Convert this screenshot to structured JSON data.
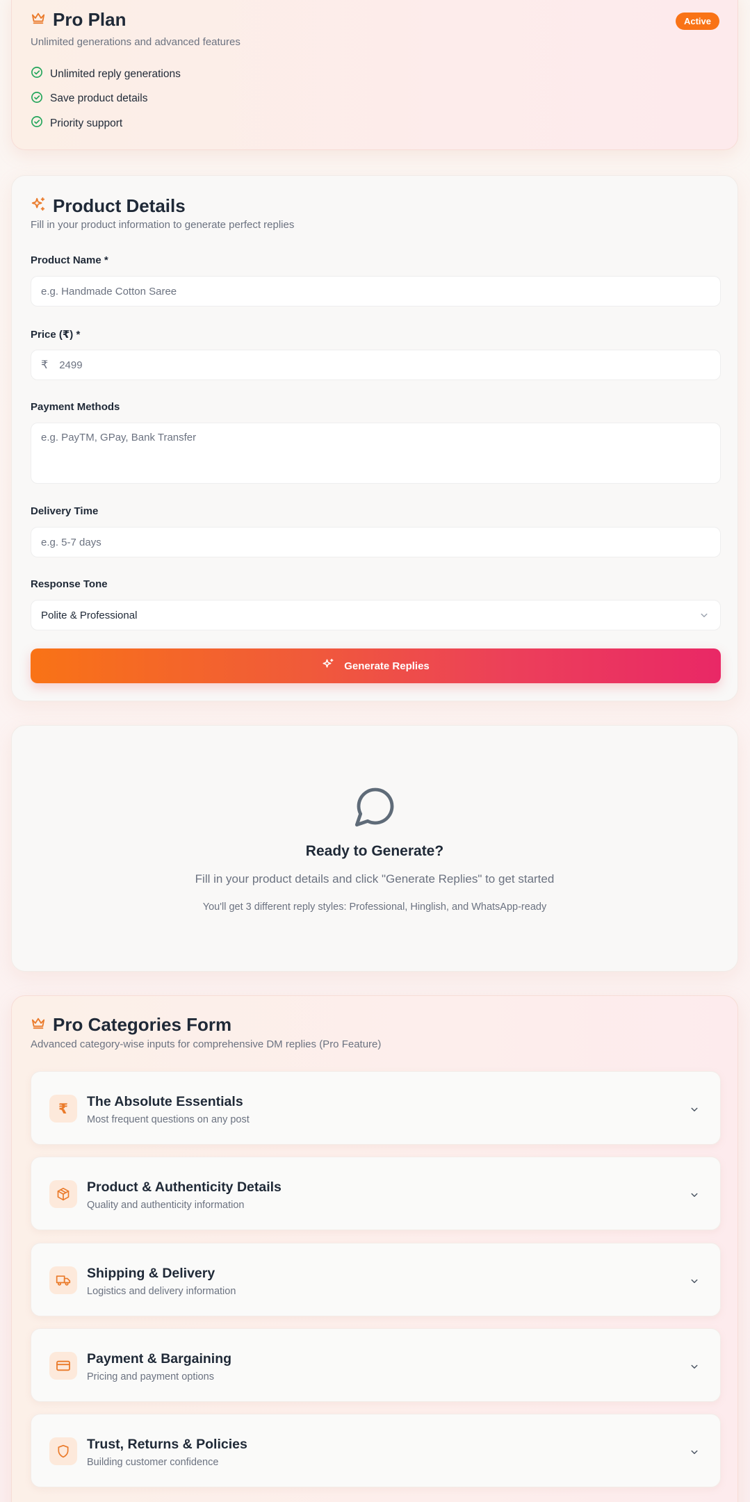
{
  "plan": {
    "title": "Pro Plan",
    "badge": "Active",
    "subtitle": "Unlimited generations and advanced features",
    "features": [
      "Unlimited reply generations",
      "Save product details",
      "Priority support"
    ]
  },
  "details": {
    "title": "Product Details",
    "subtitle": "Fill in your product information to generate perfect replies",
    "product_name": {
      "label": "Product Name *",
      "placeholder": "e.g. Handmade Cotton Saree"
    },
    "price": {
      "label": "Price (₹) *",
      "prefix": "₹",
      "placeholder": "2499"
    },
    "payment": {
      "label": "Payment Methods",
      "placeholder": "e.g. PayTM, GPay, Bank Transfer"
    },
    "delivery": {
      "label": "Delivery Time",
      "placeholder": "e.g. 5-7 days"
    },
    "tone": {
      "label": "Response Tone",
      "value": "Polite & Professional"
    },
    "generate_label": "Generate Replies"
  },
  "empty": {
    "title": "Ready to Generate?",
    "description": "Fill in your product details and click \"Generate Replies\" to get started",
    "note": "You'll get 3 different reply styles: Professional, Hinglish, and WhatsApp-ready"
  },
  "categories": {
    "title": "Pro Categories Form",
    "subtitle": "Advanced category-wise inputs for comprehensive DM replies (Pro Feature)",
    "items": [
      {
        "title": "The Absolute Essentials",
        "subtitle": "Most frequent questions on any post",
        "icon": "rupee-icon"
      },
      {
        "title": "Product & Authenticity Details",
        "subtitle": "Quality and authenticity information",
        "icon": "package-icon"
      },
      {
        "title": "Shipping & Delivery",
        "subtitle": "Logistics and delivery information",
        "icon": "truck-icon"
      },
      {
        "title": "Payment & Bargaining",
        "subtitle": "Pricing and payment options",
        "icon": "credit-card-icon"
      },
      {
        "title": "Trust, Returns & Policies",
        "subtitle": "Building customer confidence",
        "icon": "shield-icon"
      }
    ]
  },
  "colors": {
    "accent": "#f97316",
    "gradient_end": "#e92866",
    "success": "#22a55a",
    "text": "#1f2937",
    "muted": "#6b7280"
  }
}
